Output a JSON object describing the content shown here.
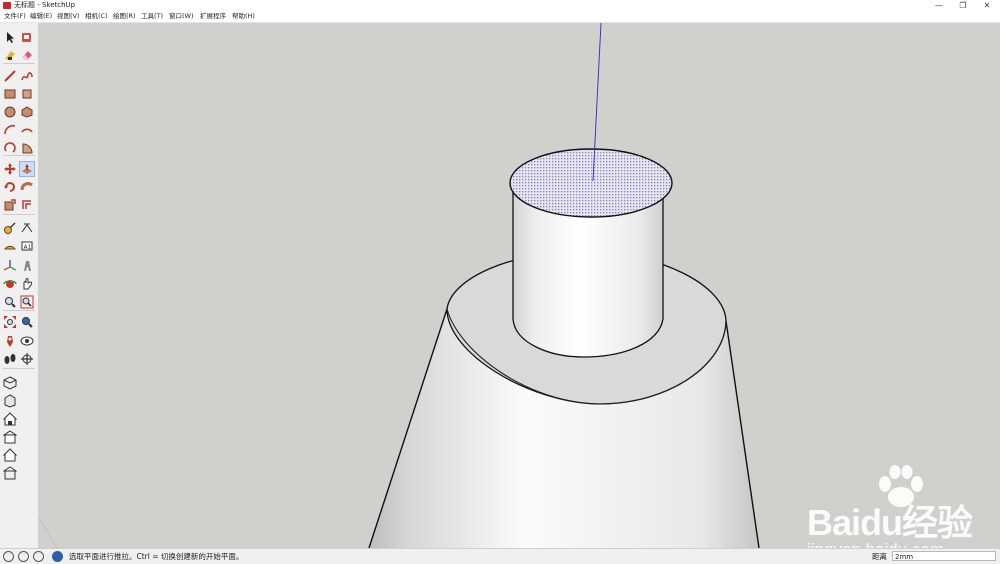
{
  "window": {
    "title": "无标题 - SketchUp",
    "controls": {
      "minimize": "—",
      "restore": "❐",
      "close": "✕"
    }
  },
  "menu": [
    {
      "label": "文件(F)"
    },
    {
      "label": "编辑(E)"
    },
    {
      "label": "视图(V)"
    },
    {
      "label": "相机(C)"
    },
    {
      "label": "绘图(R)"
    },
    {
      "label": "工具(T)"
    },
    {
      "label": "窗口(W)"
    },
    {
      "label": "扩展程序"
    },
    {
      "label": "帮助(H)"
    }
  ],
  "toolbar": {
    "tools": [
      "select-tool",
      "paint-bucket-tool",
      "eraser-tool-alt",
      "eraser-tool",
      "line-tool",
      "freehand-tool",
      "rectangle-tool",
      "rotated-rectangle-tool",
      "circle-tool",
      "polygon-tool",
      "arc-tool",
      "two-point-arc-tool",
      "three-point-arc-tool",
      "pie-tool",
      "move-tool",
      "push-pull-tool",
      "rotate-tool",
      "follow-me-tool",
      "scale-tool",
      "offset-tool",
      "tape-measure-tool",
      "dimension-tool",
      "protractor-tool",
      "text-tool",
      "axes-tool",
      "3d-text-tool",
      "orbit-tool",
      "pan-tool",
      "zoom-tool",
      "zoom-window-tool",
      "zoom-extents-tool",
      "previous-view-tool",
      "position-camera-tool",
      "look-around-tool",
      "walk-tool",
      "section-plane-tool"
    ],
    "active_tool": "push-pull-tool",
    "views": [
      "iso-view",
      "top-view",
      "front-view",
      "right-view",
      "back-view",
      "left-view"
    ]
  },
  "colors": {
    "viewport_bg": "#d0d0cc",
    "face_light": "#f4f4f4",
    "face_shade": "#e2e2e2",
    "selected_face": "#bcc0d8",
    "blue_axis": "#2b2bc8",
    "toolbar_bg": "#f0f0f0"
  },
  "watermark": {
    "brand": "Baidu经验",
    "sub": "jingyan.baidu.com"
  },
  "status": {
    "message": "选取平面进行推拉。Ctrl = 切换创建新的开始平面。",
    "measurement_label": "距离",
    "measurement_value": "2mm"
  }
}
